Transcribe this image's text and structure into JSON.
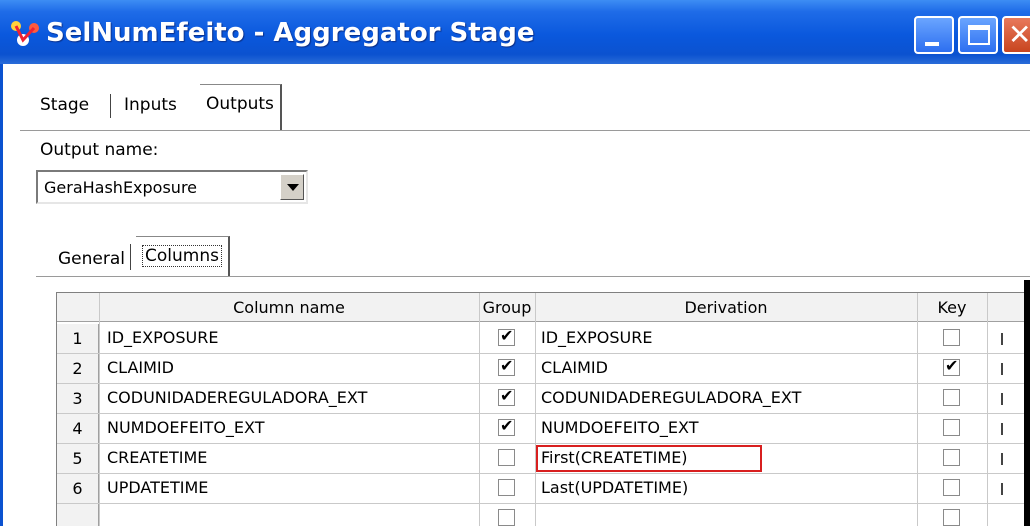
{
  "window": {
    "title": "SelNumEfeito - Aggregator Stage",
    "icon": "aggregator-stage-icon",
    "buttons": [
      "minimize",
      "maximize",
      "close"
    ]
  },
  "tabs": [
    "Stage",
    "Inputs",
    "Outputs"
  ],
  "active_tab": "Outputs",
  "output": {
    "label": "Output name:",
    "selected": "GeraHashExposure"
  },
  "subtabs": [
    "General",
    "Columns"
  ],
  "active_subtab": "Columns",
  "grid": {
    "headers": {
      "column_name": "Column name",
      "group": "Group",
      "derivation": "Derivation",
      "key": "Key"
    },
    "rows": [
      {
        "num": "1",
        "name": "ID_EXPOSURE",
        "group": true,
        "derivation": "ID_EXPOSURE",
        "key": false
      },
      {
        "num": "2",
        "name": "CLAIMID",
        "group": true,
        "derivation": "CLAIMID",
        "key": true
      },
      {
        "num": "3",
        "name": "CODUNIDADEREGULADORA_EXT",
        "group": true,
        "derivation": "CODUNIDADEREGULADORA_EXT",
        "key": false
      },
      {
        "num": "4",
        "name": "NUMDOEFEITO_EXT",
        "group": true,
        "derivation": "NUMDOEFEITO_EXT",
        "key": false
      },
      {
        "num": "5",
        "name": "CREATETIME",
        "group": false,
        "derivation": "First(CREATETIME)",
        "key": false,
        "highlighted": true
      },
      {
        "num": "6",
        "name": "UPDATETIME",
        "group": false,
        "derivation": "Last(UPDATETIME)",
        "key": false
      }
    ],
    "highlight_color": "#d81f1f"
  },
  "colors": {
    "titlebar": "#0b52d0",
    "title_text": "#ffffff"
  }
}
